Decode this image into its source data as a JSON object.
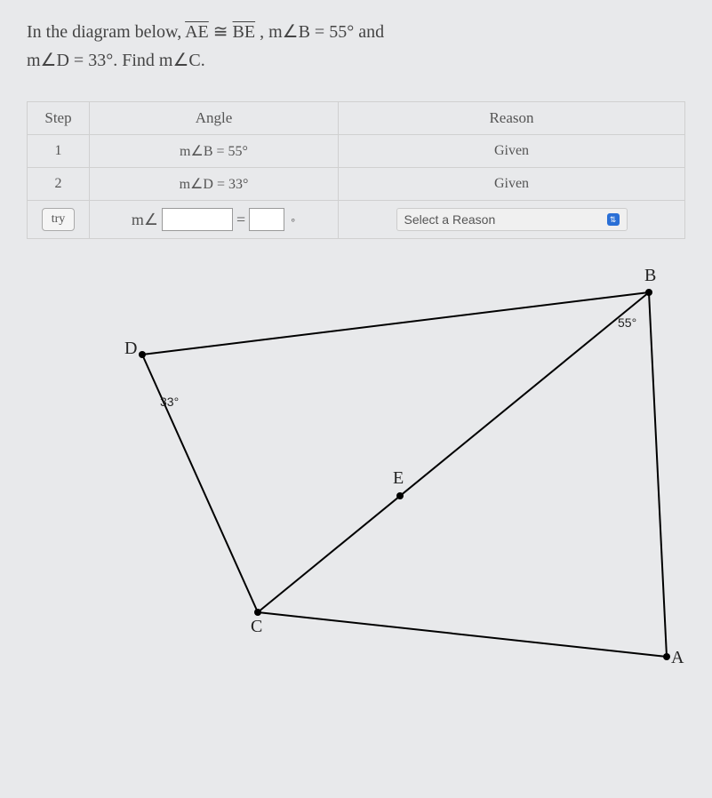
{
  "problem": {
    "prefix": "In the diagram below, ",
    "seg1": "AE",
    "cong": " ≅ ",
    "seg2": "BE",
    "mid": ",  m∠B = 55° and",
    "line2": "m∠D = 33°. Find m∠C."
  },
  "table": {
    "headers": {
      "step": "Step",
      "angle": "Angle",
      "reason": "Reason"
    },
    "rows": [
      {
        "step": "1",
        "angle": "m∠B = 55°",
        "reason": "Given"
      },
      {
        "step": "2",
        "angle": "m∠D = 33°",
        "reason": "Given"
      }
    ],
    "try_row": {
      "try_label": "try",
      "prefix": "m∠",
      "equals": "=",
      "deg": "∘",
      "select_placeholder": "Select a Reason"
    }
  },
  "diagram": {
    "points": {
      "B": "B",
      "D": "D",
      "E": "E",
      "C": "C",
      "A": "A"
    },
    "angles": {
      "D": "33°",
      "B": "55°"
    }
  },
  "chart_data": {
    "type": "table",
    "title": "Geometry two-column proof setup",
    "given": [
      "AE ≅ BE",
      "m∠B = 55°",
      "m∠D = 33°"
    ],
    "find": "m∠C",
    "rows": [
      {
        "step": 1,
        "statement": "m∠B = 55°",
        "reason": "Given"
      },
      {
        "step": 2,
        "statement": "m∠D = 33°",
        "reason": "Given"
      },
      {
        "step": "try",
        "statement": "m∠__ = __°",
        "reason": "Select a Reason"
      }
    ],
    "diagram_points": [
      "A",
      "B",
      "C",
      "D",
      "E"
    ],
    "diagram_angles": {
      "D": 33,
      "B": 55
    }
  }
}
